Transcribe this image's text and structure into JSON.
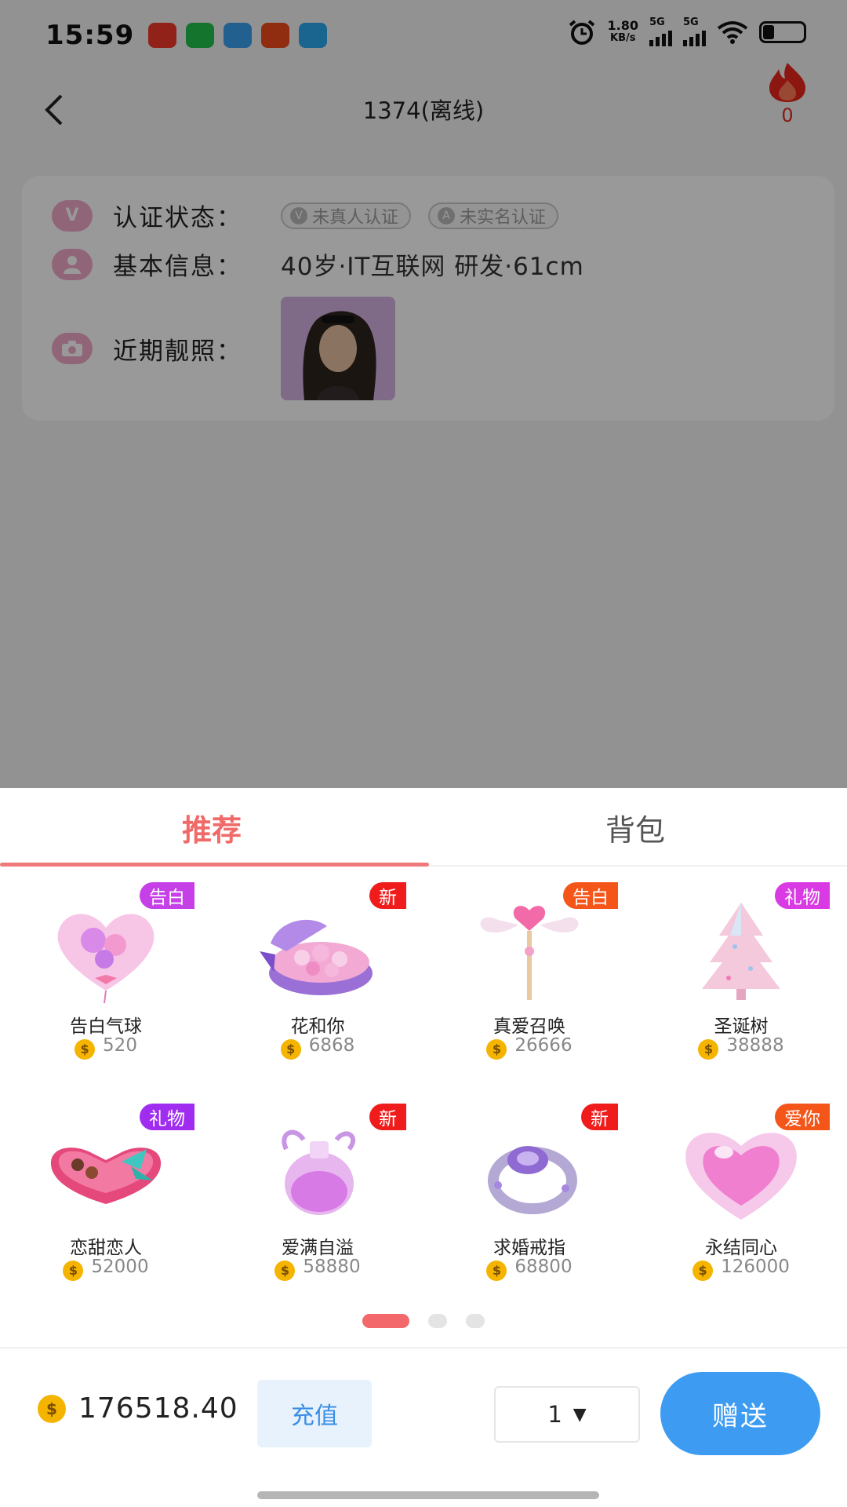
{
  "status_bar": {
    "time": "15:59",
    "net_speed_value": "1.80",
    "net_speed_unit": "KB/s",
    "signal1_label": "5G",
    "signal2_label": "5G"
  },
  "header": {
    "title": "1374(离线)",
    "heat_count": "0"
  },
  "profile": {
    "verify_label": "认证状态：",
    "verify_badges": [
      "未真人认证",
      "未实名认证"
    ],
    "basic_label": "基本信息：",
    "basic_text": "40岁·IT互联网 研发·61cm",
    "photo_label": "近期靓照："
  },
  "gift_panel": {
    "tabs": [
      {
        "label": "推荐",
        "active": true
      },
      {
        "label": "背包",
        "active": false
      }
    ],
    "gifts": [
      {
        "name": "告白气球",
        "price": "520",
        "tag": "告白",
        "tag_color": "#c640e8"
      },
      {
        "name": "花和你",
        "price": "6868",
        "tag": "新",
        "tag_color": "#f01c1c"
      },
      {
        "name": "真爱召唤",
        "price": "26666",
        "tag": "告白",
        "tag_color": "#f4561a"
      },
      {
        "name": "圣诞树",
        "price": "38888",
        "tag": "礼物",
        "tag_color": "#d93ae3"
      },
      {
        "name": "恋甜恋人",
        "price": "52000",
        "tag": "礼物",
        "tag_color": "#a02cf0"
      },
      {
        "name": "爱满自溢",
        "price": "58880",
        "tag": "新",
        "tag_color": "#f01c1c"
      },
      {
        "name": "求婚戒指",
        "price": "68800",
        "tag": "新",
        "tag_color": "#f01c1c"
      },
      {
        "name": "永结同心",
        "price": "126000",
        "tag": "爱你",
        "tag_color": "#f4561a"
      }
    ],
    "page_count": 3,
    "current_page": 1
  },
  "footer": {
    "balance": "176518.40",
    "recharge_label": "充值",
    "quantity": "1",
    "send_label": "赠送"
  },
  "colors": {
    "accent_red": "#f06a6a",
    "send_blue": "#3d9cf2",
    "recharge_bg": "#e8f2fc",
    "recharge_text": "#3a8ee6"
  }
}
